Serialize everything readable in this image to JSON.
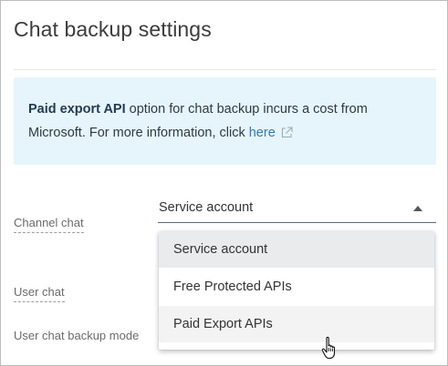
{
  "page": {
    "title": "Chat backup settings"
  },
  "info": {
    "bold_text": "Paid export API",
    "text_line1": " option for chat backup incurs a cost from",
    "text_line2": "Microsoft. For more information, click ",
    "link_text": "here",
    "link_icon": "external-link-icon",
    "background_color": "#e6f5fb"
  },
  "fields": {
    "channel_chat": {
      "label": "Channel chat",
      "selected_value": "Service account",
      "options": [
        "Service account",
        "Free Protected APIs",
        "Paid Export APIs"
      ]
    },
    "user_chat": {
      "label": "User chat"
    },
    "user_chat_backup_mode": {
      "label": "User chat backup mode"
    }
  },
  "colors": {
    "link": "#2f7bbf",
    "selected_option_bg": "#e9ebed",
    "hover_option_bg": "#f3f3f3"
  },
  "cursor": {
    "icon": "hand-pointer-icon"
  }
}
